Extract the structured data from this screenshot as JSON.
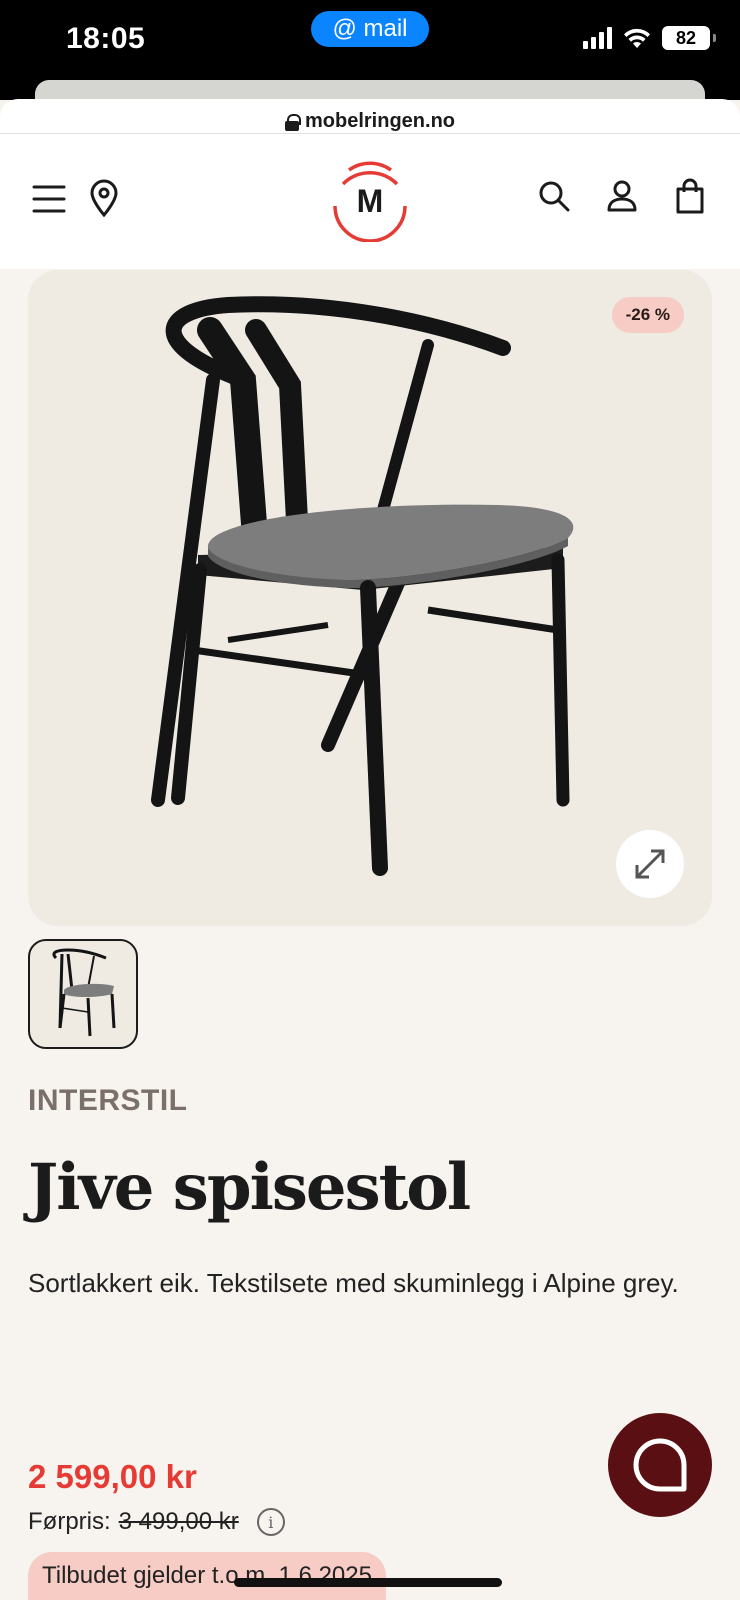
{
  "status_bar": {
    "time": "18:05",
    "pill_label": "@ mail",
    "battery": "82"
  },
  "browser": {
    "url": "mobelringen.no"
  },
  "header": {
    "logo_letter": "M",
    "icons": [
      "menu-icon",
      "location-pin-icon",
      "search-icon",
      "account-icon",
      "shopping-bag-icon"
    ],
    "logo_color": "#e63a35"
  },
  "product": {
    "discount_badge": "-26 %",
    "brand": "INTERSTIL",
    "title": "Jive spisestol",
    "description": "Sortlakkert eik. Tekstilsete med skuminlegg i Alpine grey.",
    "price": "2 599,00 kr",
    "previous_price_label": "Førpris:",
    "previous_price": "3 499,00 kr",
    "offer_text": "Tilbudet gjelder t.o.m. 1.6.2025"
  },
  "colors": {
    "background": "#f7f3ef",
    "price": "#e63a35",
    "chat_button": "#5a0f12",
    "badge": "#f6ccc5"
  }
}
